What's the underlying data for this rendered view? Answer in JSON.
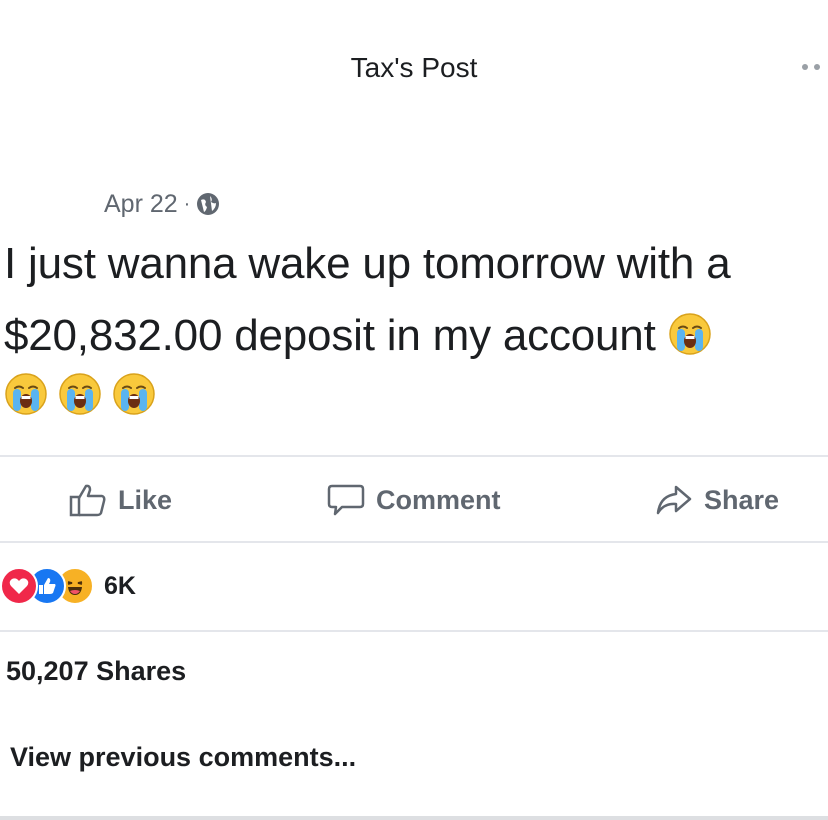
{
  "header": {
    "title": "Tax's Post"
  },
  "post": {
    "date": "Apr 22",
    "separator": "·",
    "audience_icon": "globe-icon",
    "text_line1": "I just wanna wake up tomorrow with a",
    "text_line2": "$20,832.00 deposit in my account",
    "emoji": "crying-face-emoji",
    "trailing_emoji_count": 3
  },
  "actions": {
    "like_label": "Like",
    "comment_label": "Comment",
    "share_label": "Share"
  },
  "reactions": {
    "types": [
      "love",
      "like",
      "haha"
    ],
    "count": "6K"
  },
  "stats": {
    "shares": "50,207 Shares"
  },
  "comments": {
    "view_previous": "View previous comments..."
  },
  "colors": {
    "text": "#1c1e21",
    "muted": "#606770",
    "love": "#f0284a",
    "like": "#1877f2",
    "haha": "#f7b125"
  }
}
